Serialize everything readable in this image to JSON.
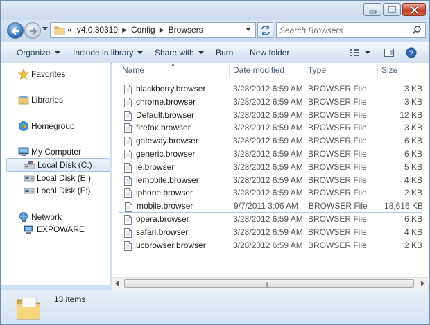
{
  "window": {
    "controls": {
      "minimize_icon": "minimize-icon",
      "maximize_icon": "maximize-icon",
      "close_icon": "close-icon"
    }
  },
  "address": {
    "overflow": "«",
    "crumbs": [
      "v4.0.30319",
      "Config",
      "Browsers"
    ]
  },
  "search": {
    "placeholder": "Search Browsers"
  },
  "toolbar": {
    "organize": "Organize",
    "include_in_library": "Include in library",
    "share_with": "Share with",
    "burn": "Burn",
    "new_folder": "New folder"
  },
  "nav": {
    "favorites": "Favorites",
    "libraries": "Libraries",
    "homegroup": "Homegroup",
    "my_computer": "My Computer",
    "drives": [
      "Local Disk (C:)",
      "Local Disk (E:)",
      "Local Disk (F:)"
    ],
    "network": "Network",
    "network_items": [
      "EXPOWARE"
    ]
  },
  "columns": {
    "name": "Name",
    "date": "Date modified",
    "type": "Type",
    "size": "Size"
  },
  "files": [
    {
      "name": "blackberry.browser",
      "date": "3/28/2012 6:59 AM",
      "type": "BROWSER File",
      "size": "3 KB"
    },
    {
      "name": "chrome.browser",
      "date": "3/28/2012 6:59 AM",
      "type": "BROWSER File",
      "size": "3 KB"
    },
    {
      "name": "Default.browser",
      "date": "3/28/2012 6:59 AM",
      "type": "BROWSER File",
      "size": "12 KB"
    },
    {
      "name": "firefox.browser",
      "date": "3/28/2012 6:59 AM",
      "type": "BROWSER File",
      "size": "3 KB"
    },
    {
      "name": "gateway.browser",
      "date": "3/28/2012 6:59 AM",
      "type": "BROWSER File",
      "size": "6 KB"
    },
    {
      "name": "generic.browser",
      "date": "3/28/2012 6:59 AM",
      "type": "BROWSER File",
      "size": "6 KB"
    },
    {
      "name": "ie.browser",
      "date": "3/28/2012 6:59 AM",
      "type": "BROWSER File",
      "size": "5 KB"
    },
    {
      "name": "iemobile.browser",
      "date": "3/28/2012 6:59 AM",
      "type": "BROWSER File",
      "size": "4 KB"
    },
    {
      "name": "iphone.browser",
      "date": "3/28/2012 6:59 AM",
      "type": "BROWSER File",
      "size": "2 KB"
    },
    {
      "name": "mobile.browser",
      "date": "9/7/2011 3:06 AM",
      "type": "BROWSER File",
      "size": "18,616 KB"
    },
    {
      "name": "opera.browser",
      "date": "3/28/2012 6:59 AM",
      "type": "BROWSER File",
      "size": "6 KB"
    },
    {
      "name": "safari.browser",
      "date": "3/28/2012 6:59 AM",
      "type": "BROWSER File",
      "size": "4 KB"
    },
    {
      "name": "ucbrowser.browser",
      "date": "3/28/2012 6:59 AM",
      "type": "BROWSER File",
      "size": "2 KB"
    }
  ],
  "status": {
    "count": "13 items"
  },
  "colors": {
    "accent": "#3a6ea5",
    "selection_border": "#aecbe9",
    "header_text": "#4c607a"
  }
}
